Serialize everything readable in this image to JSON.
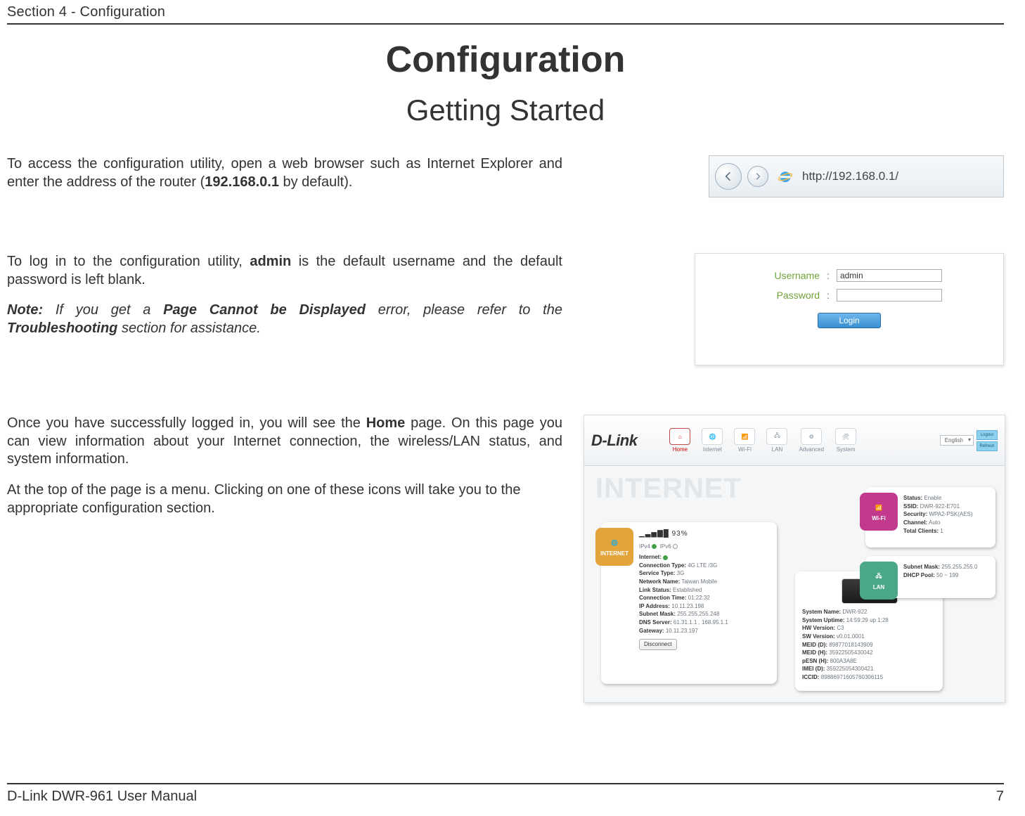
{
  "header": {
    "section": "Section 4 - Configuration"
  },
  "titles": {
    "h1": "Configuration",
    "h2": "Getting Started"
  },
  "para1": {
    "pre": "To access the configuration utility, open a web browser such as Internet Explorer and enter the address of the router (",
    "bold": "192.168.0.1",
    "post": " by default)."
  },
  "para2": {
    "pre": "To log in to the configuration utility, ",
    "bold": "admin",
    "post": " is the default username and the default password is left blank."
  },
  "note": {
    "pre_bi": "Note:",
    "mid1": " If you get a ",
    "b1": "Page Cannot be Displayed",
    "mid2": " error, please refer to the ",
    "b2": "Troubleshooting",
    "post": " section for assistance."
  },
  "para3": {
    "pre": "Once you have successfully logged in, you will see the ",
    "bold": "Home",
    "post": " page. On this page you can view information about your Internet connection, the wireless/LAN status, and system information."
  },
  "para4": "At the top of the page is a menu. Clicking on one of these icons will take you to the appropriate configuration section.",
  "browser": {
    "url": "http://192.168.0.1/"
  },
  "login": {
    "username_label": "Username",
    "password_label": "Password",
    "username_value": "admin",
    "password_value": "",
    "button": "Login"
  },
  "dash": {
    "logo": "D-Link",
    "nav": [
      "Home",
      "Internet",
      "Wi-Fi",
      "LAN",
      "Advanced",
      "System"
    ],
    "lang": "English",
    "side": [
      "Logout",
      "Refresh"
    ],
    "watermark": "INTERNET",
    "internet": {
      "tab": "INTERNET",
      "signal_pct": "93%",
      "ipv4_label": "IPv4",
      "ipv6_label": "IPv6",
      "rows": [
        {
          "k": "Internet:",
          "v": ""
        },
        {
          "k": "Connection Type:",
          "v": "4G LTE /3G"
        },
        {
          "k": "Service Type:",
          "v": "3G"
        },
        {
          "k": "Network Name:",
          "v": "Taiwan Mobile"
        },
        {
          "k": "Link Status:",
          "v": "Established"
        },
        {
          "k": "Connection Time:",
          "v": "01:22:32"
        },
        {
          "k": "IP Address:",
          "v": "10.11.23.198"
        },
        {
          "k": "Subnet Mask:",
          "v": "255.255.255.248"
        },
        {
          "k": "DNS Server:",
          "v": "61.31.1.1 , 168.95.1.1"
        },
        {
          "k": "Gateway:",
          "v": "10.11.23.197"
        }
      ],
      "disconnect": "Disconnect"
    },
    "system": {
      "rows": [
        {
          "k": "System Name:",
          "v": "DWR-922"
        },
        {
          "k": "System Uptime:",
          "v": "14:59:29 up 1:28"
        },
        {
          "k": "HW Version:",
          "v": "C3"
        },
        {
          "k": "SW Version:",
          "v": "v0.01.0001"
        },
        {
          "k": "MEID (D):",
          "v": "89877018143909"
        },
        {
          "k": "MEID (H):",
          "v": "35922505430042"
        },
        {
          "k": "pESN (H):",
          "v": "800A3A8E"
        },
        {
          "k": "IMEI (D):",
          "v": "359225054300421"
        },
        {
          "k": "ICCID:",
          "v": "89886971605760306115"
        }
      ]
    },
    "wifi": {
      "tab": "Wi-Fi",
      "rows": [
        {
          "k": "Status:",
          "v": "Enable"
        },
        {
          "k": "SSID:",
          "v": "DWR-922-E701"
        },
        {
          "k": "Security:",
          "v": "WPA2-PSK(AES)"
        },
        {
          "k": "Channel:",
          "v": "Auto"
        },
        {
          "k": "Total Clients:",
          "v": "1"
        }
      ]
    },
    "lan": {
      "tab": "LAN",
      "rows": [
        {
          "k": "Subnet Mask:",
          "v": "255.255.255.0"
        },
        {
          "k": "DHCP Pool:",
          "v": "50 ~ 199"
        }
      ]
    }
  },
  "footer": {
    "left": "D-Link DWR-961 User Manual",
    "right": "7"
  }
}
